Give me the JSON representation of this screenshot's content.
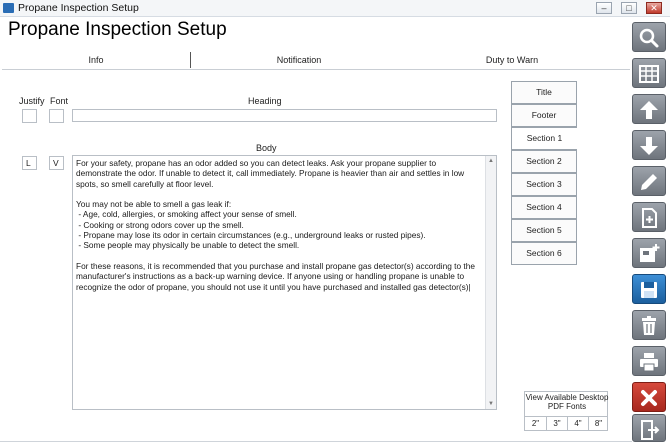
{
  "window": {
    "title": "Propane Inspection Setup",
    "minimize_glyph": "–",
    "maximize_glyph": "□",
    "close_glyph": "✕"
  },
  "page": {
    "title": "Propane Inspection Setup"
  },
  "tabs": [
    {
      "label": "Info"
    },
    {
      "label": "Notification"
    },
    {
      "label": "Duty to Warn"
    }
  ],
  "labels": {
    "justify": "Justify",
    "font": "Font",
    "heading": "Heading",
    "body": "Body"
  },
  "fields": {
    "heading_justify": "",
    "heading_font": "",
    "heading_value": "",
    "body_justify": "L",
    "body_font": "V",
    "body_value": "For your safety, propane has an odor added so you can detect leaks. Ask your propane supplier to demonstrate the odor. If unable to detect it, call immediately. Propane is heavier than air and settles in low spots, so smell carefully at floor level.\n\nYou may not be able to smell a gas leak if:\n - Age, cold, allergies, or smoking affect your sense of smell.\n - Cooking or strong odors cover up the smell.\n - Propane may lose its odor in certain circumstances (e.g., underground leaks or rusted pipes).\n - Some people may physically be unable to detect the smell.\n\nFor these reasons, it is recommended that you purchase and install propane gas detector(s) according to the manufacturer's instructions as a back-up warning device. If anyone using or handling propane is unable to recognize the odor of propane, you should not use it until you have purchased and installed gas detector(s)|"
  },
  "sections": [
    {
      "label": "Title"
    },
    {
      "label": "Footer"
    },
    {
      "label": "Section 1",
      "active": true
    },
    {
      "label": "Section 2"
    },
    {
      "label": "Section 3"
    },
    {
      "label": "Section 4"
    },
    {
      "label": "Section 5"
    },
    {
      "label": "Section 6"
    }
  ],
  "pdf_fonts": {
    "label": "View Available Desktop PDF Fonts",
    "sizes": [
      "2\"",
      "3\"",
      "4\"",
      "8\""
    ]
  },
  "toolbar": [
    {
      "icon": "search-icon"
    },
    {
      "icon": "grid-icon"
    },
    {
      "icon": "arrow-up-icon"
    },
    {
      "icon": "arrow-down-icon"
    },
    {
      "icon": "pencil-icon"
    },
    {
      "icon": "new-document-icon"
    },
    {
      "icon": "add-record-icon"
    },
    {
      "icon": "save-icon"
    },
    {
      "icon": "trash-icon"
    },
    {
      "icon": "print-icon"
    },
    {
      "icon": "cancel-icon"
    },
    {
      "icon": "exit-icon"
    }
  ],
  "colors": {
    "accent_blue": "#1c5f9e",
    "cancel_red": "#a8281e",
    "toolbar_gray": "#6e747c"
  }
}
